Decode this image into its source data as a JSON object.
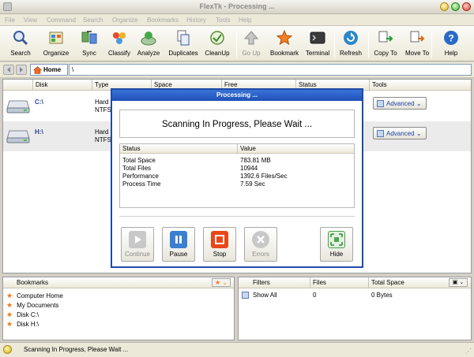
{
  "window": {
    "title": "FlexTk - Processing ..."
  },
  "menu": [
    "File",
    "View",
    "Command",
    "Search",
    "Organize",
    "Bookmarks",
    "History",
    "Tools",
    "Help"
  ],
  "toolbar": {
    "search": "Search",
    "organize": "Organize",
    "sync": "Sync",
    "classify": "Classify",
    "analyze": "Analyze",
    "duplicates": "Duplicates",
    "cleanup": "CleanUp",
    "goup": "Go Up",
    "bookmark": "Bookmark",
    "terminal": "Terminal",
    "refresh": "Refresh",
    "copyto": "Copy To",
    "moveto": "Move To",
    "help": "Help"
  },
  "address": {
    "home_label": "Home",
    "path": "\\"
  },
  "disks": {
    "columns": {
      "disk": "Disk",
      "type": "Type",
      "space": "Space",
      "free": "Free",
      "status": "Status",
      "tools": "Tools"
    },
    "rows": [
      {
        "name": "C:\\",
        "type_line1": "Hard D",
        "type_line2": "NTFS",
        "tool": "Advanced"
      },
      {
        "name": "H:\\",
        "type_line1": "Hard D",
        "type_line2": "NTFS",
        "tool": "Advanced"
      }
    ]
  },
  "dialog": {
    "title": "Processing ...",
    "message": "Scanning In Progress, Please Wait ...",
    "columns": {
      "status": "Status",
      "value": "Value"
    },
    "rows": [
      {
        "status": "Total Space",
        "value": "783.81 MB"
      },
      {
        "status": "Total Files",
        "value": "10944"
      },
      {
        "status": "Performance",
        "value": "1392.6 Files/Sec"
      },
      {
        "status": "Process Time",
        "value": "7.59 Sec"
      }
    ],
    "buttons": {
      "continue": "Continue",
      "pause": "Pause",
      "stop": "Stop",
      "errors": "Errors",
      "hide": "Hide"
    }
  },
  "bookmarks": {
    "header": "Bookmarks",
    "items": [
      "Computer Home",
      "My Documents",
      "Disk C:\\",
      "Disk H:\\"
    ]
  },
  "filters": {
    "columns": {
      "filters": "Filters",
      "files": "Files",
      "total_space": "Total Space"
    },
    "rows": [
      {
        "filter": "Show All",
        "files": "0",
        "space": "0 Bytes"
      }
    ]
  },
  "status": {
    "text": "Scanning In Progress, Please Wait ..."
  },
  "colors": {
    "accent": "#1f4ba8",
    "bookmark_star": "#f07818",
    "pause": "#3a7fd0",
    "stop": "#e84818"
  }
}
